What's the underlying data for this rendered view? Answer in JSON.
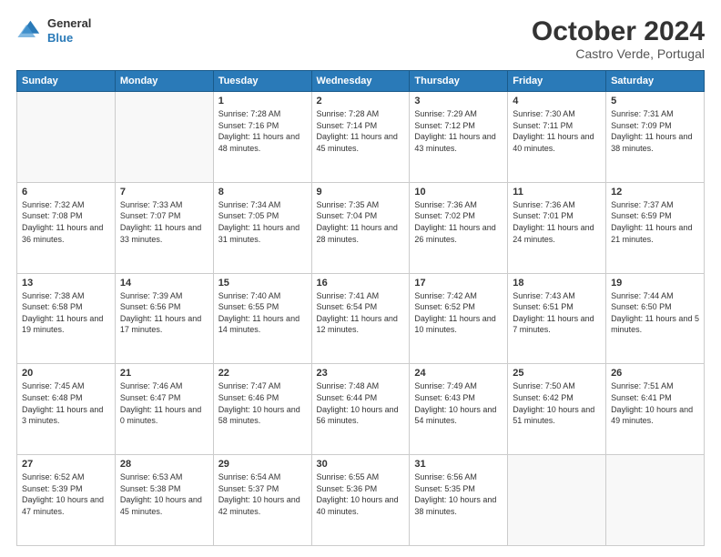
{
  "logo": {
    "line1": "General",
    "line2": "Blue"
  },
  "title": "October 2024",
  "subtitle": "Castro Verde, Portugal",
  "days_of_week": [
    "Sunday",
    "Monday",
    "Tuesday",
    "Wednesday",
    "Thursday",
    "Friday",
    "Saturday"
  ],
  "weeks": [
    [
      {
        "num": "",
        "info": ""
      },
      {
        "num": "",
        "info": ""
      },
      {
        "num": "1",
        "info": "Sunrise: 7:28 AM\nSunset: 7:16 PM\nDaylight: 11 hours\nand 48 minutes."
      },
      {
        "num": "2",
        "info": "Sunrise: 7:28 AM\nSunset: 7:14 PM\nDaylight: 11 hours\nand 45 minutes."
      },
      {
        "num": "3",
        "info": "Sunrise: 7:29 AM\nSunset: 7:12 PM\nDaylight: 11 hours\nand 43 minutes."
      },
      {
        "num": "4",
        "info": "Sunrise: 7:30 AM\nSunset: 7:11 PM\nDaylight: 11 hours\nand 40 minutes."
      },
      {
        "num": "5",
        "info": "Sunrise: 7:31 AM\nSunset: 7:09 PM\nDaylight: 11 hours\nand 38 minutes."
      }
    ],
    [
      {
        "num": "6",
        "info": "Sunrise: 7:32 AM\nSunset: 7:08 PM\nDaylight: 11 hours\nand 36 minutes."
      },
      {
        "num": "7",
        "info": "Sunrise: 7:33 AM\nSunset: 7:07 PM\nDaylight: 11 hours\nand 33 minutes."
      },
      {
        "num": "8",
        "info": "Sunrise: 7:34 AM\nSunset: 7:05 PM\nDaylight: 11 hours\nand 31 minutes."
      },
      {
        "num": "9",
        "info": "Sunrise: 7:35 AM\nSunset: 7:04 PM\nDaylight: 11 hours\nand 28 minutes."
      },
      {
        "num": "10",
        "info": "Sunrise: 7:36 AM\nSunset: 7:02 PM\nDaylight: 11 hours\nand 26 minutes."
      },
      {
        "num": "11",
        "info": "Sunrise: 7:36 AM\nSunset: 7:01 PM\nDaylight: 11 hours\nand 24 minutes."
      },
      {
        "num": "12",
        "info": "Sunrise: 7:37 AM\nSunset: 6:59 PM\nDaylight: 11 hours\nand 21 minutes."
      }
    ],
    [
      {
        "num": "13",
        "info": "Sunrise: 7:38 AM\nSunset: 6:58 PM\nDaylight: 11 hours\nand 19 minutes."
      },
      {
        "num": "14",
        "info": "Sunrise: 7:39 AM\nSunset: 6:56 PM\nDaylight: 11 hours\nand 17 minutes."
      },
      {
        "num": "15",
        "info": "Sunrise: 7:40 AM\nSunset: 6:55 PM\nDaylight: 11 hours\nand 14 minutes."
      },
      {
        "num": "16",
        "info": "Sunrise: 7:41 AM\nSunset: 6:54 PM\nDaylight: 11 hours\nand 12 minutes."
      },
      {
        "num": "17",
        "info": "Sunrise: 7:42 AM\nSunset: 6:52 PM\nDaylight: 11 hours\nand 10 minutes."
      },
      {
        "num": "18",
        "info": "Sunrise: 7:43 AM\nSunset: 6:51 PM\nDaylight: 11 hours\nand 7 minutes."
      },
      {
        "num": "19",
        "info": "Sunrise: 7:44 AM\nSunset: 6:50 PM\nDaylight: 11 hours\nand 5 minutes."
      }
    ],
    [
      {
        "num": "20",
        "info": "Sunrise: 7:45 AM\nSunset: 6:48 PM\nDaylight: 11 hours\nand 3 minutes."
      },
      {
        "num": "21",
        "info": "Sunrise: 7:46 AM\nSunset: 6:47 PM\nDaylight: 11 hours\nand 0 minutes."
      },
      {
        "num": "22",
        "info": "Sunrise: 7:47 AM\nSunset: 6:46 PM\nDaylight: 10 hours\nand 58 minutes."
      },
      {
        "num": "23",
        "info": "Sunrise: 7:48 AM\nSunset: 6:44 PM\nDaylight: 10 hours\nand 56 minutes."
      },
      {
        "num": "24",
        "info": "Sunrise: 7:49 AM\nSunset: 6:43 PM\nDaylight: 10 hours\nand 54 minutes."
      },
      {
        "num": "25",
        "info": "Sunrise: 7:50 AM\nSunset: 6:42 PM\nDaylight: 10 hours\nand 51 minutes."
      },
      {
        "num": "26",
        "info": "Sunrise: 7:51 AM\nSunset: 6:41 PM\nDaylight: 10 hours\nand 49 minutes."
      }
    ],
    [
      {
        "num": "27",
        "info": "Sunrise: 6:52 AM\nSunset: 5:39 PM\nDaylight: 10 hours\nand 47 minutes."
      },
      {
        "num": "28",
        "info": "Sunrise: 6:53 AM\nSunset: 5:38 PM\nDaylight: 10 hours\nand 45 minutes."
      },
      {
        "num": "29",
        "info": "Sunrise: 6:54 AM\nSunset: 5:37 PM\nDaylight: 10 hours\nand 42 minutes."
      },
      {
        "num": "30",
        "info": "Sunrise: 6:55 AM\nSunset: 5:36 PM\nDaylight: 10 hours\nand 40 minutes."
      },
      {
        "num": "31",
        "info": "Sunrise: 6:56 AM\nSunset: 5:35 PM\nDaylight: 10 hours\nand 38 minutes."
      },
      {
        "num": "",
        "info": ""
      },
      {
        "num": "",
        "info": ""
      }
    ]
  ]
}
